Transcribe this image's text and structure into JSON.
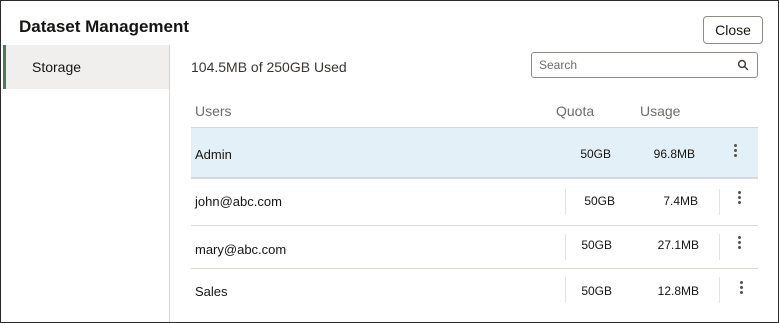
{
  "dialog": {
    "title": "Dataset Management",
    "close_label": "Close"
  },
  "sidebar": {
    "items": [
      {
        "label": "Storage",
        "selected": true
      }
    ]
  },
  "main": {
    "usage_summary": "104.5MB of 250GB Used",
    "search": {
      "placeholder": "Search",
      "value": "",
      "icon": "search-icon"
    },
    "table": {
      "headers": {
        "users": "Users",
        "quota": "Quota",
        "usage": "Usage"
      },
      "rows": [
        {
          "user": "Admin",
          "quota": "50GB",
          "usage": "96.8MB",
          "selected": true,
          "actions_icon": "kebab-menu-icon"
        },
        {
          "user": "john@abc.com",
          "quota": "50GB",
          "usage": "7.4MB",
          "selected": false,
          "actions_icon": "kebab-menu-icon"
        },
        {
          "user": "mary@abc.com",
          "quota": "50GB",
          "usage": "27.1MB",
          "selected": false,
          "actions_icon": "kebab-menu-icon"
        },
        {
          "user": "Sales",
          "quota": "50GB",
          "usage": "12.8MB",
          "selected": false,
          "actions_icon": "kebab-menu-icon"
        }
      ]
    }
  },
  "colors": {
    "selected_row_bg": "#e4f0f7",
    "sidebar_selected_bg": "#f1efed",
    "sidebar_accent": "#4a7c59"
  }
}
